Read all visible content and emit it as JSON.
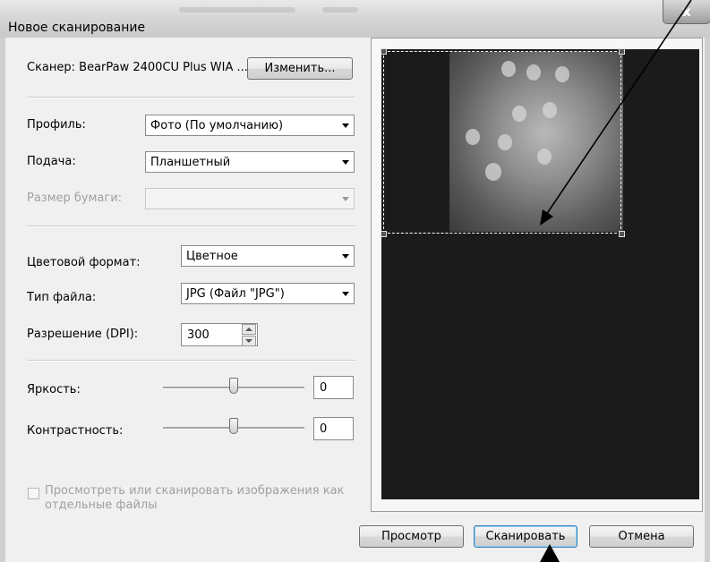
{
  "window": {
    "title": "Новое сканирование",
    "close_glyph": "x"
  },
  "scanner": {
    "label": "Сканер: BearPaw 2400CU Plus WIA ...",
    "change_button": "Изменить..."
  },
  "profile": {
    "label": "Профиль:",
    "value": "Фото (По умолчанию)"
  },
  "source": {
    "label": "Подача:",
    "value": "Планшетный"
  },
  "paper_size": {
    "label": "Размер бумаги:",
    "value": ""
  },
  "color_format": {
    "label": "Цветовой формат:",
    "value": "Цветное"
  },
  "file_type": {
    "label": "Тип файла:",
    "value": "JPG (Файл \"JPG\")"
  },
  "resolution": {
    "label": "Разрешение (DPI):",
    "value": "300"
  },
  "brightness": {
    "label": "Яркость:",
    "value": "0",
    "level": 0.5
  },
  "contrast": {
    "label": "Контрастность:",
    "value": "0",
    "level": 0.5
  },
  "separate_files": {
    "label_line1": "Просмотреть или сканировать изображения как",
    "label_line2": "отдельные файлы",
    "checked": false
  },
  "buttons": {
    "preview": "Просмотр",
    "scan": "Сканировать",
    "cancel": "Отмена"
  }
}
